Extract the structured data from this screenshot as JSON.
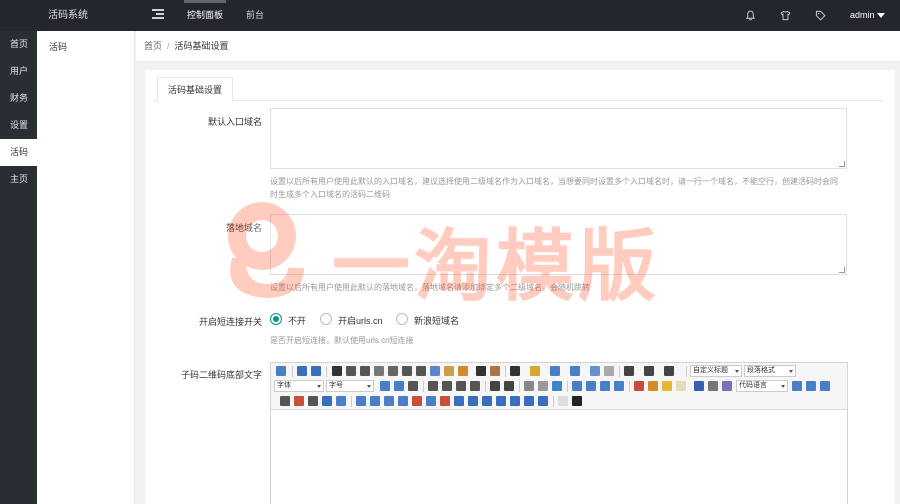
{
  "app": {
    "title": "活码系统"
  },
  "topnav": {
    "items": [
      {
        "label": "控制面板",
        "active": true
      },
      {
        "label": "前台",
        "active": false
      }
    ],
    "user": "admin"
  },
  "sidebar": {
    "items": [
      {
        "label": "首页",
        "active": false
      },
      {
        "label": "用户",
        "active": false
      },
      {
        "label": "财务",
        "active": false
      },
      {
        "label": "设置",
        "active": false
      },
      {
        "label": "活码",
        "active": true
      },
      {
        "label": "主页",
        "active": false
      }
    ]
  },
  "subsidebar": {
    "items": [
      {
        "label": "活码"
      }
    ]
  },
  "breadcrumb": {
    "home": "首页",
    "separator": "/",
    "current": "活码基础设置"
  },
  "tabs": [
    {
      "label": "活码基础设置",
      "active": true
    }
  ],
  "form": {
    "entry_domain": {
      "label": "默认入口域名",
      "value": "",
      "help": "设置以后所有用户使用此默认的入口域名，建议选择使用二级域名作为入口域名，当想要同时设置多个入口域名时，请一行一个域名，不能空行，创建活码时会同时生成多个入口域名的活码二维码"
    },
    "landing_domain": {
      "label": "落地域名",
      "value": "",
      "help": "设置以后所有用户使用此默认的落地域名，落地域名请添加绑定多个二级域名，会随机跳转"
    },
    "short_link": {
      "label": "开启短连接开关",
      "options": [
        {
          "label": "不开",
          "checked": true
        },
        {
          "label": "开启urls.cn",
          "checked": false
        },
        {
          "label": "新浪短域名",
          "checked": false
        }
      ],
      "help": "是否开启短连接，默认使用urls.cn短连接"
    },
    "qr_footer": {
      "label": "子码二维码底部文字",
      "editor": {
        "selects": [
          "自定义标题",
          "段落格式",
          "字体",
          "字号",
          "代码语言"
        ],
        "content": ""
      }
    }
  },
  "watermark": {
    "text": "一淘模版"
  },
  "colors": {
    "accent": "#009688",
    "topbar": "#23262e",
    "sidebar": "#2a2d33"
  }
}
